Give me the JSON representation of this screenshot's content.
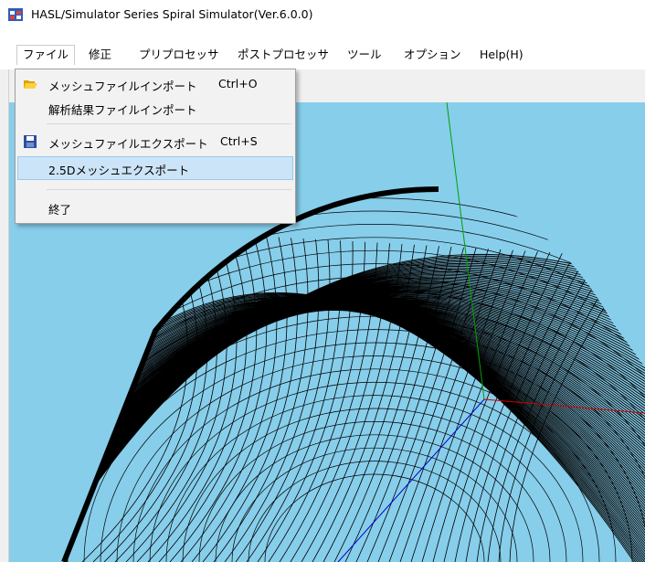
{
  "window": {
    "title": "HASL/Simulator Series Spiral Simulator(Ver.6.0.0)",
    "icon": "app-window-icon"
  },
  "menubar": {
    "items": [
      {
        "label": "ファイル",
        "active": true
      },
      {
        "label": "修正"
      },
      {
        "label": "プリプロセッサ"
      },
      {
        "label": "ポストプロセッサ"
      },
      {
        "label": "ツール"
      },
      {
        "label": "オプション"
      },
      {
        "label": "Help(H)"
      }
    ]
  },
  "file_menu": {
    "items": [
      {
        "label": "メッシュファイルインポート",
        "shortcut": "Ctrl+O",
        "icon": "open-folder-icon"
      },
      {
        "label": "解析結果ファイルインポート"
      },
      {
        "label": "メッシュファイルエクスポート",
        "shortcut": "Ctrl+S",
        "icon": "save-disk-icon"
      },
      {
        "label": "2.5Dメッシュエクスポート",
        "highlighted": true
      },
      {
        "label": "終了"
      }
    ]
  },
  "viewport": {
    "background": "#87ceeb",
    "axis_colors": {
      "y": "#00a000",
      "x": "#d00000",
      "z": "#0000cc"
    }
  }
}
